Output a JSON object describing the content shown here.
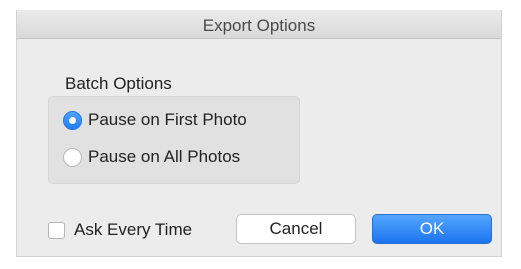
{
  "dialog": {
    "title": "Export Options"
  },
  "batch_options": {
    "label": "Batch Options",
    "options": [
      {
        "label": "Pause on First Photo",
        "selected": true
      },
      {
        "label": "Pause on All Photos",
        "selected": false
      }
    ]
  },
  "ask_every_time": {
    "label": "Ask Every Time",
    "checked": false
  },
  "buttons": {
    "cancel_label": "Cancel",
    "ok_label": "OK"
  },
  "colors": {
    "accent": "#1f7cf4",
    "dialog_background": "#ececec",
    "group_background": "#e1e1e1"
  }
}
